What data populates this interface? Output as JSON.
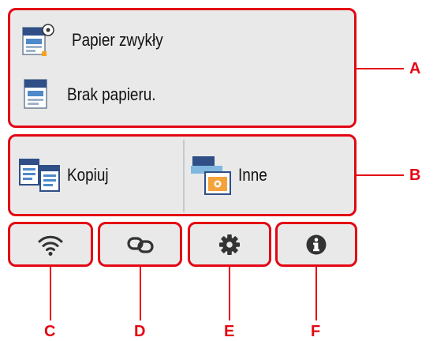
{
  "paper": {
    "paper_type": "Papier zwykły",
    "paper_status": "Brak papieru."
  },
  "functions": {
    "copy_label": "Kopiuj",
    "other_label": "Inne"
  },
  "buttons": {
    "wifi": "wifi-icon",
    "direct_connection": "link-icon",
    "setup": "gear-icon",
    "info": "info-icon"
  },
  "callouts": {
    "a": "A",
    "b": "B",
    "c": "C",
    "d": "D",
    "e": "E",
    "f": "F"
  },
  "colors": {
    "callout": "#e30613",
    "panel": "#e9e9ea",
    "icon": "#333333"
  }
}
